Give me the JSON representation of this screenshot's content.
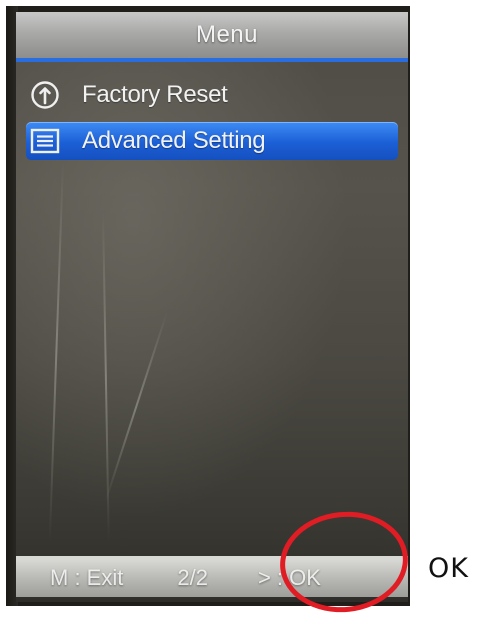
{
  "screen": {
    "title": "Menu",
    "items": [
      {
        "label": "Factory Reset",
        "icon": "reset-icon",
        "selected": false
      },
      {
        "label": "Advanced Setting",
        "icon": "list-settings-icon",
        "selected": true
      }
    ],
    "footer": {
      "exit_hint": "M : Exit",
      "page_indicator": "2/2",
      "ok_hint": "> : OK"
    }
  },
  "annotation": {
    "label": "OK",
    "ring_color": "#e01c24"
  },
  "colors": {
    "accent_blue": "#2a6de0",
    "selected_item": "#1c5fd6"
  }
}
